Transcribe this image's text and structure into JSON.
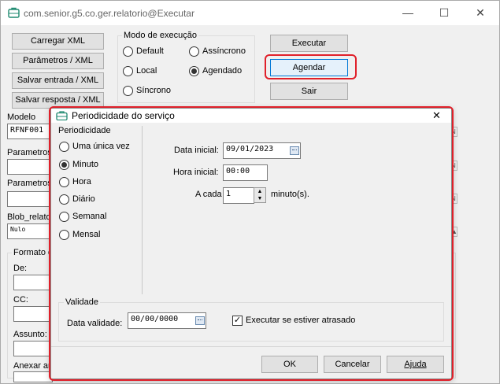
{
  "window": {
    "title": "com.senior.g5.co.ger.relatorio@Executar",
    "minimize_icon": "—",
    "maximize_icon": "☐",
    "close_icon": "✕"
  },
  "left_buttons": [
    "Carregar XML",
    "Parâmetros / XML",
    "Salvar entrada / XML",
    "Salvar resposta / XML"
  ],
  "mode": {
    "label": "Modo de execução",
    "options": [
      "Default",
      "Assíncrono",
      "Local",
      "Agendado",
      "Síncrono"
    ],
    "selected": "Agendado"
  },
  "right_buttons": {
    "execute": "Executar",
    "schedule": "Agendar",
    "exit": "Sair"
  },
  "fields": {
    "modelo_label": "Modelo",
    "modelo_value": "RFNF001",
    "param1_label": "Parametros",
    "param2_label": "Parametros",
    "blob_label": "Blob_relato",
    "blob_value": "Nulo",
    "format_label": "Formato d",
    "from_label": "De:",
    "cc_label": "CC:",
    "subject_label": "Assunto:",
    "attach_label": "Anexar ar"
  },
  "dialog": {
    "title": "Periodicidade do serviço",
    "close_icon": "✕",
    "periodicity_label": "Periodicidade",
    "options": [
      "Uma única vez",
      "Minuto",
      "Hora",
      "Diário",
      "Semanal",
      "Mensal"
    ],
    "selected": "Minuto",
    "start_date_label": "Data inicial:",
    "start_date": "09/01/2023",
    "start_time_label": "Hora inicial:",
    "start_time": "00:00",
    "every_label": "A cada",
    "every_value": "1",
    "every_unit": "minuto(s).",
    "validity_label": "Validade",
    "valid_date_label": "Data validade:",
    "valid_date": "00/00/0000",
    "late_label": "Executar se estiver atrasado",
    "late_checked": true,
    "ok": "OK",
    "cancel": "Cancelar",
    "help": "Ajuda"
  }
}
